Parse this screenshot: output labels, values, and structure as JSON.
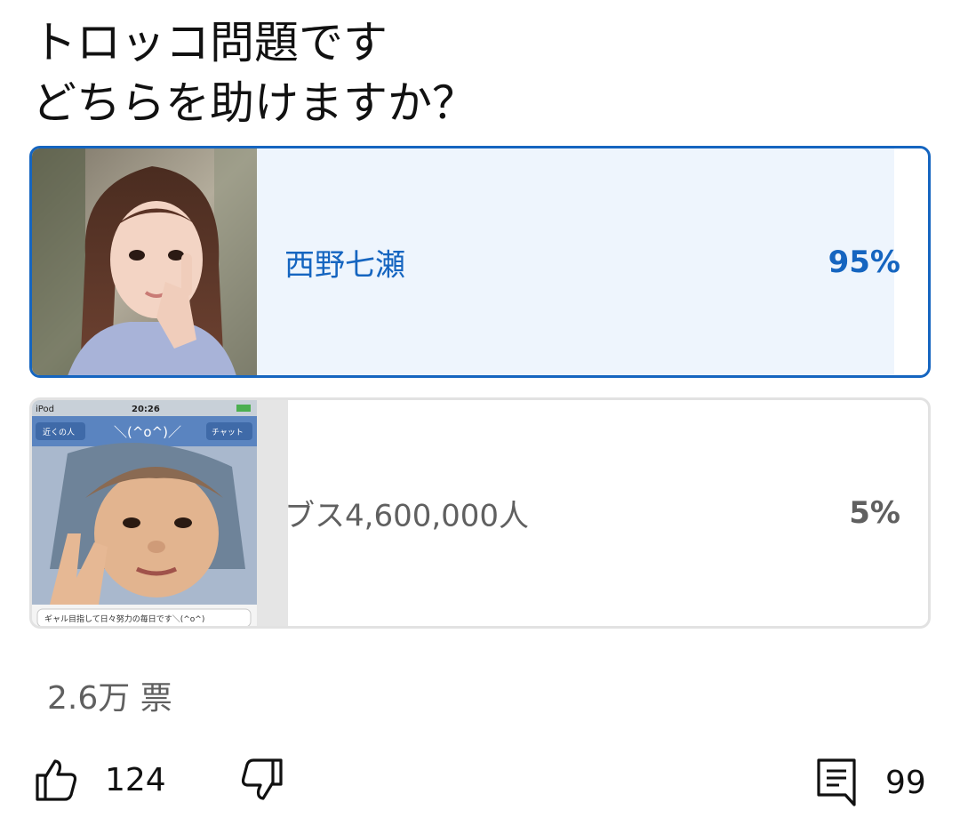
{
  "poll": {
    "question_line1": "トロッコ問題です",
    "question_line2": "どちらを助けますか？",
    "options": [
      {
        "label": "西野七瀬",
        "percent": "95%",
        "percent_value": 95,
        "selected": true
      },
      {
        "label": "ブス4,600,000人",
        "percent": "5%",
        "percent_value": 5,
        "selected": false,
        "thumbnail": {
          "status_device": "iPod",
          "status_time": "20:26",
          "nav_back": "近くの人",
          "nav_title": "＼(^o^)／",
          "nav_right": "チャット",
          "caption": "ギャル目指して日々努力の毎日です＼(^o^)"
        }
      }
    ],
    "votes": "2.6万 票"
  },
  "actions": {
    "like_count": "124",
    "comment_count": "99"
  },
  "colors": {
    "accent": "#1565c0",
    "selected_fill": "#eef5fd",
    "other_fill": "#e5e5e5",
    "muted_text": "#606060"
  }
}
